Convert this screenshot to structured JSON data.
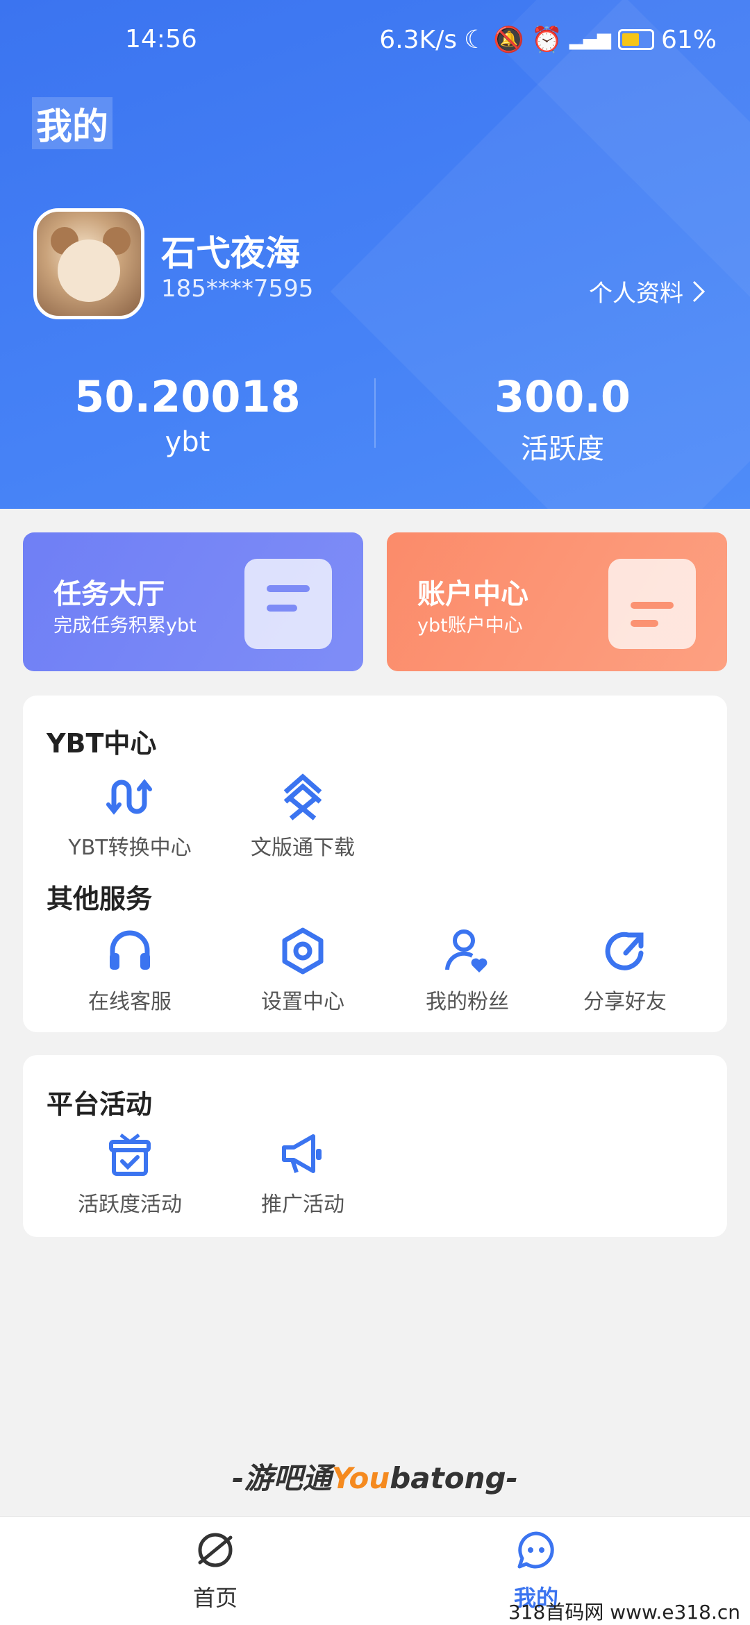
{
  "status_bar": {
    "time": "14:56",
    "net_speed": "6.3K/s",
    "battery": "61%"
  },
  "page_title": "我的",
  "user": {
    "name": "石弋夜海",
    "phone": "185****7595",
    "profile_link": "个人资料"
  },
  "stats": [
    {
      "value": "50.20018",
      "label": "ybt"
    },
    {
      "value": "300.0",
      "label": "活跃度"
    }
  ],
  "cards": [
    {
      "title": "任务大厅",
      "subtitle": "完成任务积累ybt"
    },
    {
      "title": "账户中心",
      "subtitle": "ybt账户中心"
    }
  ],
  "ybt_center": {
    "title": "YBT中心",
    "items": [
      {
        "label": "YBT转换中心",
        "icon": "convert-icon"
      },
      {
        "label": "文版通下载",
        "icon": "download-icon"
      }
    ]
  },
  "other_services": {
    "title": "其他服务",
    "items": [
      {
        "label": "在线客服",
        "icon": "headset-icon"
      },
      {
        "label": "设置中心",
        "icon": "gear-icon"
      },
      {
        "label": "我的粉丝",
        "icon": "user-heart-icon"
      },
      {
        "label": "分享好友",
        "icon": "share-icon"
      }
    ]
  },
  "platform_activity": {
    "title": "平台活动",
    "items": [
      {
        "label": "活跃度活动",
        "icon": "gift-icon"
      },
      {
        "label": "推广活动",
        "icon": "megaphone-icon"
      }
    ]
  },
  "brand": {
    "prefix": "-游吧通",
    "highlight": "You",
    "suffix": "batong-"
  },
  "tabbar": {
    "home": "首页",
    "mine": "我的"
  },
  "watermark": "318首码网 www.e318.cn",
  "colors": {
    "primary": "#3b74f0",
    "task_card": "#7584f6",
    "account_card": "#fc9474",
    "brand_accent": "#f58a1f"
  }
}
